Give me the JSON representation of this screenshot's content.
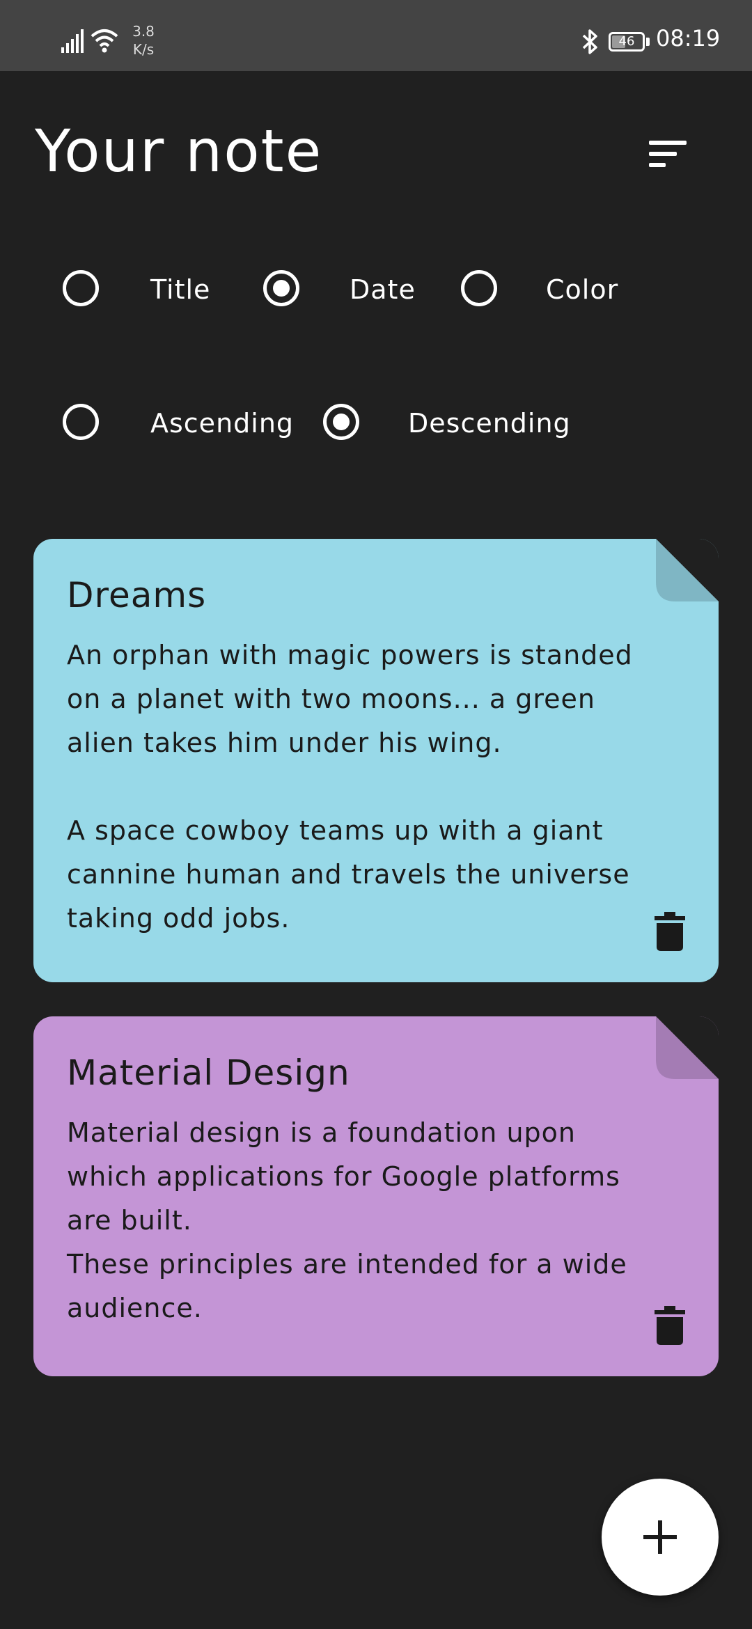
{
  "status_bar": {
    "net_speed_value": "3.8",
    "net_speed_unit": "K/s",
    "battery": "46",
    "battery_level_percent": 46,
    "time": "08:19"
  },
  "header": {
    "title": "Your note",
    "sort_icon": "sort-lines-icon"
  },
  "sort_by": {
    "options": [
      "Title",
      "Date",
      "Color"
    ],
    "selected": "Date"
  },
  "order": {
    "options": [
      "Ascending",
      "Descending"
    ],
    "selected": "Descending"
  },
  "notes": [
    {
      "title": "Dreams",
      "body": "An orphan with magic powers is standed\non a planet with two moons... a green\nalien takes him under his wing.\n\nA space cowboy teams up with a giant\ncannine human and travels the universe\ntaking odd jobs.",
      "color": "#98D9E8",
      "fold_color": "#7FB6C4"
    },
    {
      "title": "Material Design",
      "body": "Material design is a foundation upon\nwhich applications for Google platforms\nare built.\nThese principles are intended for a wide\naudience.",
      "color": "#C495D6",
      "fold_color": "#A47CB4"
    }
  ],
  "fab": {
    "icon": "plus-icon"
  },
  "colors": {
    "background": "#202020",
    "status_bar": "#444444",
    "fab": "#FFFFFF"
  }
}
